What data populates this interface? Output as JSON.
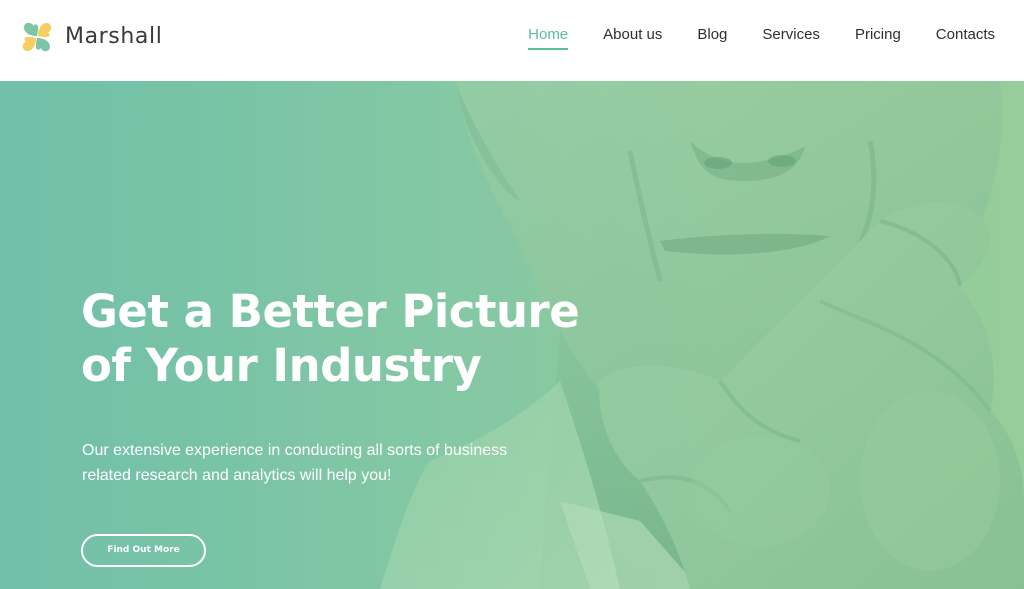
{
  "brand": {
    "name": "Marshall",
    "logo_colors": [
      "#7cc6a6",
      "#f5cf62"
    ]
  },
  "nav": {
    "items": [
      {
        "label": "Home",
        "active": true
      },
      {
        "label": "About us"
      },
      {
        "label": "Blog"
      },
      {
        "label": "Services"
      },
      {
        "label": "Pricing"
      },
      {
        "label": "Contacts"
      }
    ],
    "active_color": "#5cbf94"
  },
  "hero": {
    "title_line1": "Get a Better Picture",
    "title_line2": "of Your Industry",
    "description_line1": "Our extensive experience in conducting all sorts of business",
    "description_line2": "related research and analytics will help you!",
    "button_label": "Find Out More",
    "tint_color": "#84c8a4"
  }
}
